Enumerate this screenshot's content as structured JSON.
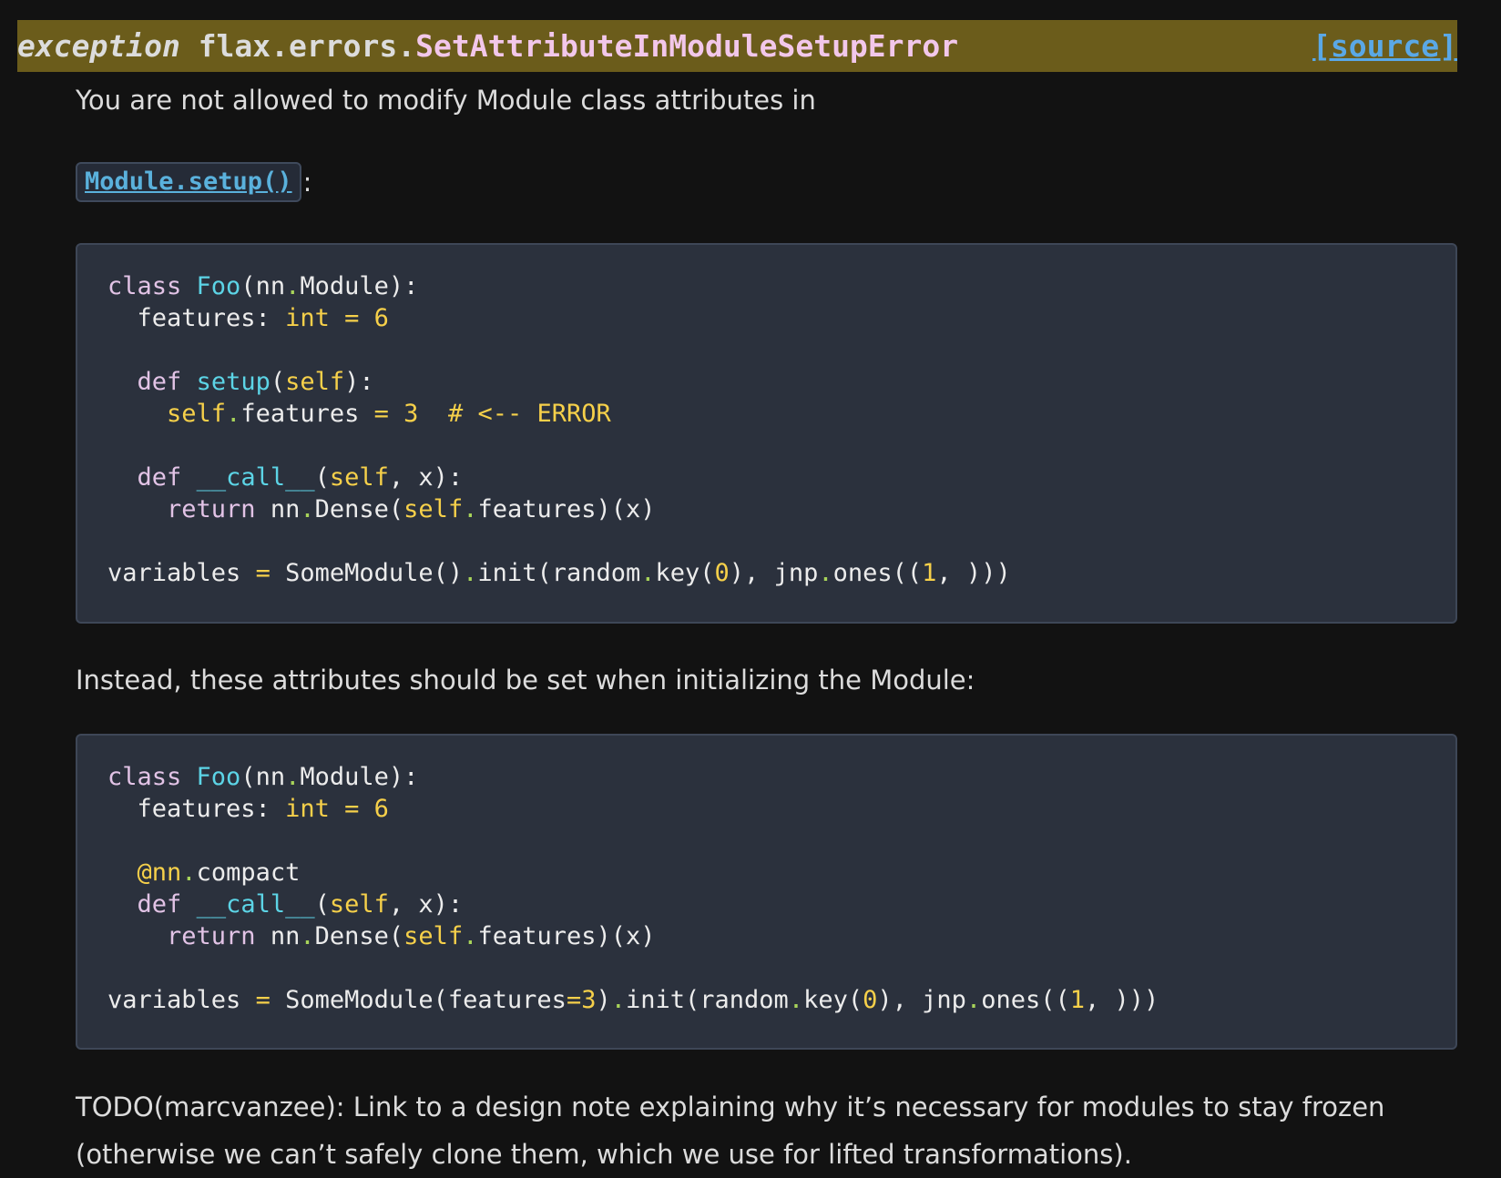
{
  "header": {
    "keyword": "exception",
    "prefix": "flax.errors.",
    "name": "SetAttributeInModuleSetupError",
    "source_label": "[source]"
  },
  "body": {
    "intro": "You are not allowed to modify Module class attributes in",
    "setup_link": "Module.setup()",
    "colon": ":",
    "instead": "Instead, these attributes should be set when initializing the Module:",
    "todo": "TODO(marcvanzee): Link to a design note explaining why it’s necessary for modules to stay frozen (otherwise we can’t safely clone them, which we use for lifted transformations)."
  },
  "code": {
    "block1": [
      "class Foo(nn.Module):",
      "  features: int = 6",
      "",
      "  def setup(self):",
      "    self.features = 3  # <-- ERROR",
      "",
      "  def __call__(self, x):",
      "    return nn.Dense(self.features)(x)",
      "",
      "variables = SomeModule().init(random.key(0), jnp.ones((1, )))"
    ],
    "block2": [
      "class Foo(nn.Module):",
      "  features: int = 6",
      "",
      "  @nn.compact",
      "  def __call__(self, x):",
      "    return nn.Dense(self.features)(x)",
      "",
      "variables = SomeModule(features=3).init(random.key(0), jnp.ones((1, )))"
    ]
  },
  "colors": {
    "header_bg": "#6b5c1b",
    "exception_name": "#f2c7ea",
    "link": "#5aa8e6",
    "code_bg": "#2b313d"
  }
}
